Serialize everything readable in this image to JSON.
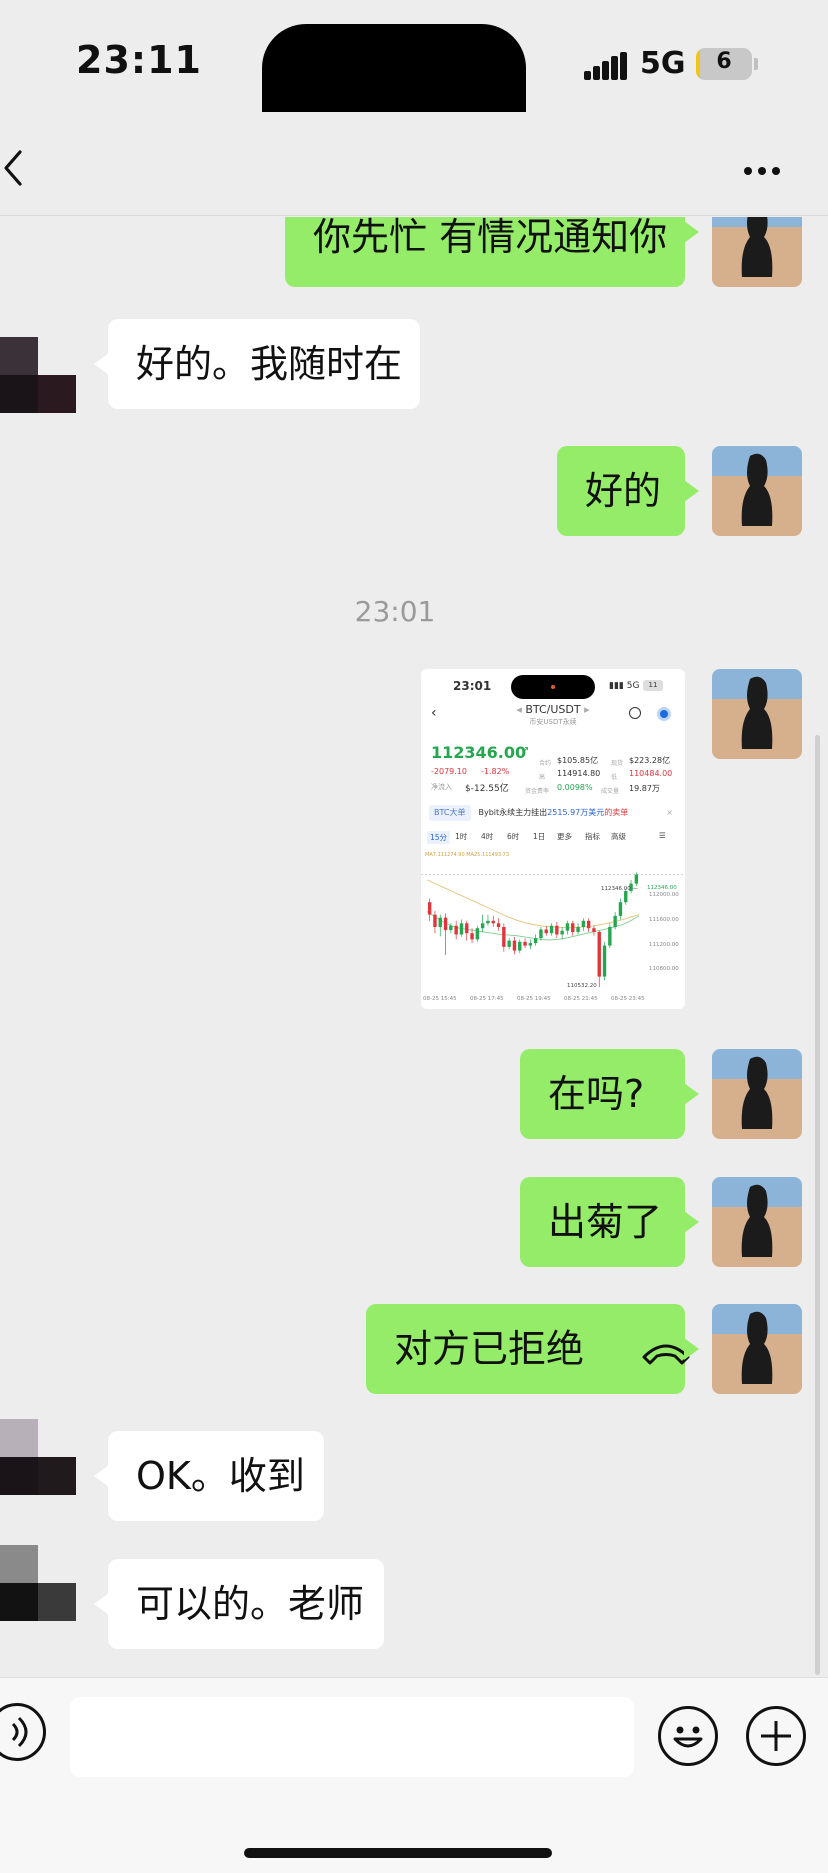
{
  "status_bar": {
    "time": "23:11",
    "network": "5G",
    "battery": "6",
    "battery_level": 0.06
  },
  "nav": {
    "title": ""
  },
  "messages": [
    {
      "text": "你先忙 有情况通知你"
    },
    {
      "text": "好的。我随时在"
    },
    {
      "text": "好的"
    },
    {
      "timestamp": "23:01"
    },
    {
      "text": "在吗?"
    },
    {
      "text": "出菊了"
    },
    {
      "text": "对方已拒绝"
    },
    {
      "text": "OK。收到"
    },
    {
      "text": "可以的。老师"
    }
  ],
  "screenshot": {
    "time": "23:01",
    "network": "5G",
    "battery": "11",
    "pair": "BTC/USDT",
    "subtitle": "币安USDT永续",
    "price": "112346.00",
    "change": "-2079.10",
    "change_pct": "-1.82%",
    "net_inflow_label": "净流入",
    "net_inflow": "$-12.55亿",
    "stats": [
      {
        "label": "合约",
        "value": "$105.85亿"
      },
      {
        "label": "现货",
        "value": "$223.28亿"
      },
      {
        "label": "高",
        "value": "114914.80"
      },
      {
        "label": "低",
        "value": "110484.00"
      },
      {
        "label": "资金费率",
        "value": "0.0098%"
      },
      {
        "label": "成交量",
        "value": "19.87万"
      }
    ],
    "announcement_tag": "BTC大单",
    "announcement_pre": "Bybit永续主力挂出",
    "announcement_amount": "2515.97万美元",
    "announcement_post": "的卖单",
    "tabs": [
      "15分",
      "1时",
      "4时",
      "6时",
      "1日",
      "更多",
      "指标",
      "高级"
    ],
    "ma_label": "MA7:111274.90 MA25:111493.73",
    "chart_data": {
      "type": "candlestick",
      "x_ticks": [
        "08-25 15:45",
        "08-25 17:45",
        "08-25 19:45",
        "08-25 21:45",
        "08-25 23:45"
      ],
      "y_ticks": [
        112346.0,
        112000.0,
        111600.0,
        111200.0,
        110800.0
      ],
      "ylim": [
        110500,
        112500
      ],
      "high_marker": 112346.0,
      "low_marker": 110532.2,
      "candles": [
        {
          "o": 111900,
          "c": 111700,
          "h": 111960,
          "l": 111600
        },
        {
          "o": 111700,
          "c": 111500,
          "h": 111760,
          "l": 111400
        },
        {
          "o": 111500,
          "c": 111650,
          "h": 111700,
          "l": 111350
        },
        {
          "o": 111650,
          "c": 111450,
          "h": 111720,
          "l": 111050
        },
        {
          "o": 111450,
          "c": 111520,
          "h": 111560,
          "l": 111400
        },
        {
          "o": 111520,
          "c": 111380,
          "h": 111600,
          "l": 111300
        },
        {
          "o": 111380,
          "c": 111560,
          "h": 111620,
          "l": 111340
        },
        {
          "o": 111560,
          "c": 111400,
          "h": 111600,
          "l": 111280
        },
        {
          "o": 111400,
          "c": 111300,
          "h": 111480,
          "l": 111240
        },
        {
          "o": 111300,
          "c": 111480,
          "h": 111520,
          "l": 111260
        },
        {
          "o": 111480,
          "c": 111560,
          "h": 111700,
          "l": 111420
        },
        {
          "o": 111560,
          "c": 111600,
          "h": 111700,
          "l": 111520
        },
        {
          "o": 111600,
          "c": 111560,
          "h": 111680,
          "l": 111500
        },
        {
          "o": 111560,
          "c": 111500,
          "h": 111640,
          "l": 111440
        },
        {
          "o": 111500,
          "c": 111180,
          "h": 111560,
          "l": 111100
        },
        {
          "o": 111180,
          "c": 111280,
          "h": 111320,
          "l": 111140
        },
        {
          "o": 111280,
          "c": 111120,
          "h": 111340,
          "l": 111060
        },
        {
          "o": 111120,
          "c": 111260,
          "h": 111300,
          "l": 111080
        },
        {
          "o": 111260,
          "c": 111200,
          "h": 111320,
          "l": 111160
        },
        {
          "o": 111200,
          "c": 111240,
          "h": 111300,
          "l": 111140
        },
        {
          "o": 111240,
          "c": 111320,
          "h": 111380,
          "l": 111200
        },
        {
          "o": 111320,
          "c": 111460,
          "h": 111500,
          "l": 111280
        },
        {
          "o": 111460,
          "c": 111400,
          "h": 111520,
          "l": 111360
        },
        {
          "o": 111400,
          "c": 111520,
          "h": 111560,
          "l": 111360
        },
        {
          "o": 111520,
          "c": 111380,
          "h": 111580,
          "l": 111320
        },
        {
          "o": 111380,
          "c": 111440,
          "h": 111500,
          "l": 111300
        },
        {
          "o": 111440,
          "c": 111560,
          "h": 111600,
          "l": 111380
        },
        {
          "o": 111560,
          "c": 111420,
          "h": 111600,
          "l": 111360
        },
        {
          "o": 111420,
          "c": 111500,
          "h": 111560,
          "l": 111380
        },
        {
          "o": 111500,
          "c": 111600,
          "h": 111640,
          "l": 111440
        },
        {
          "o": 111600,
          "c": 111480,
          "h": 111640,
          "l": 111420
        },
        {
          "o": 111480,
          "c": 111420,
          "h": 111520,
          "l": 111360
        },
        {
          "o": 111420,
          "c": 110700,
          "h": 111440,
          "l": 110532
        },
        {
          "o": 110700,
          "c": 111200,
          "h": 111260,
          "l": 110640
        },
        {
          "o": 111200,
          "c": 111500,
          "h": 111560,
          "l": 111160
        },
        {
          "o": 111500,
          "c": 111680,
          "h": 111740,
          "l": 111460
        },
        {
          "o": 111680,
          "c": 111900,
          "h": 111960,
          "l": 111620
        },
        {
          "o": 111900,
          "c": 112080,
          "h": 112120,
          "l": 111860
        },
        {
          "o": 112080,
          "c": 112200,
          "h": 112260,
          "l": 112040
        },
        {
          "o": 112200,
          "c": 112346,
          "h": 112380,
          "l": 112160
        }
      ],
      "ma_slow": [
        112260,
        112200,
        112140,
        112080,
        112020,
        111960,
        111900,
        111840,
        111780,
        111720,
        111660,
        111610,
        111570,
        111540,
        111520,
        111505,
        111495,
        111490,
        111492,
        111500,
        111512,
        111530,
        111555,
        111585,
        111620,
        111660,
        111700
      ],
      "ma_fast": [
        111750,
        111660,
        111580,
        111520,
        111480,
        111460,
        111440,
        111420,
        111400,
        111380,
        111370,
        111360,
        111340,
        111320,
        111300,
        111290,
        111300,
        111320,
        111350,
        111380,
        111410,
        111440,
        111470,
        111500,
        111540,
        111600,
        111680
      ]
    }
  },
  "input": {
    "placeholder": ""
  }
}
